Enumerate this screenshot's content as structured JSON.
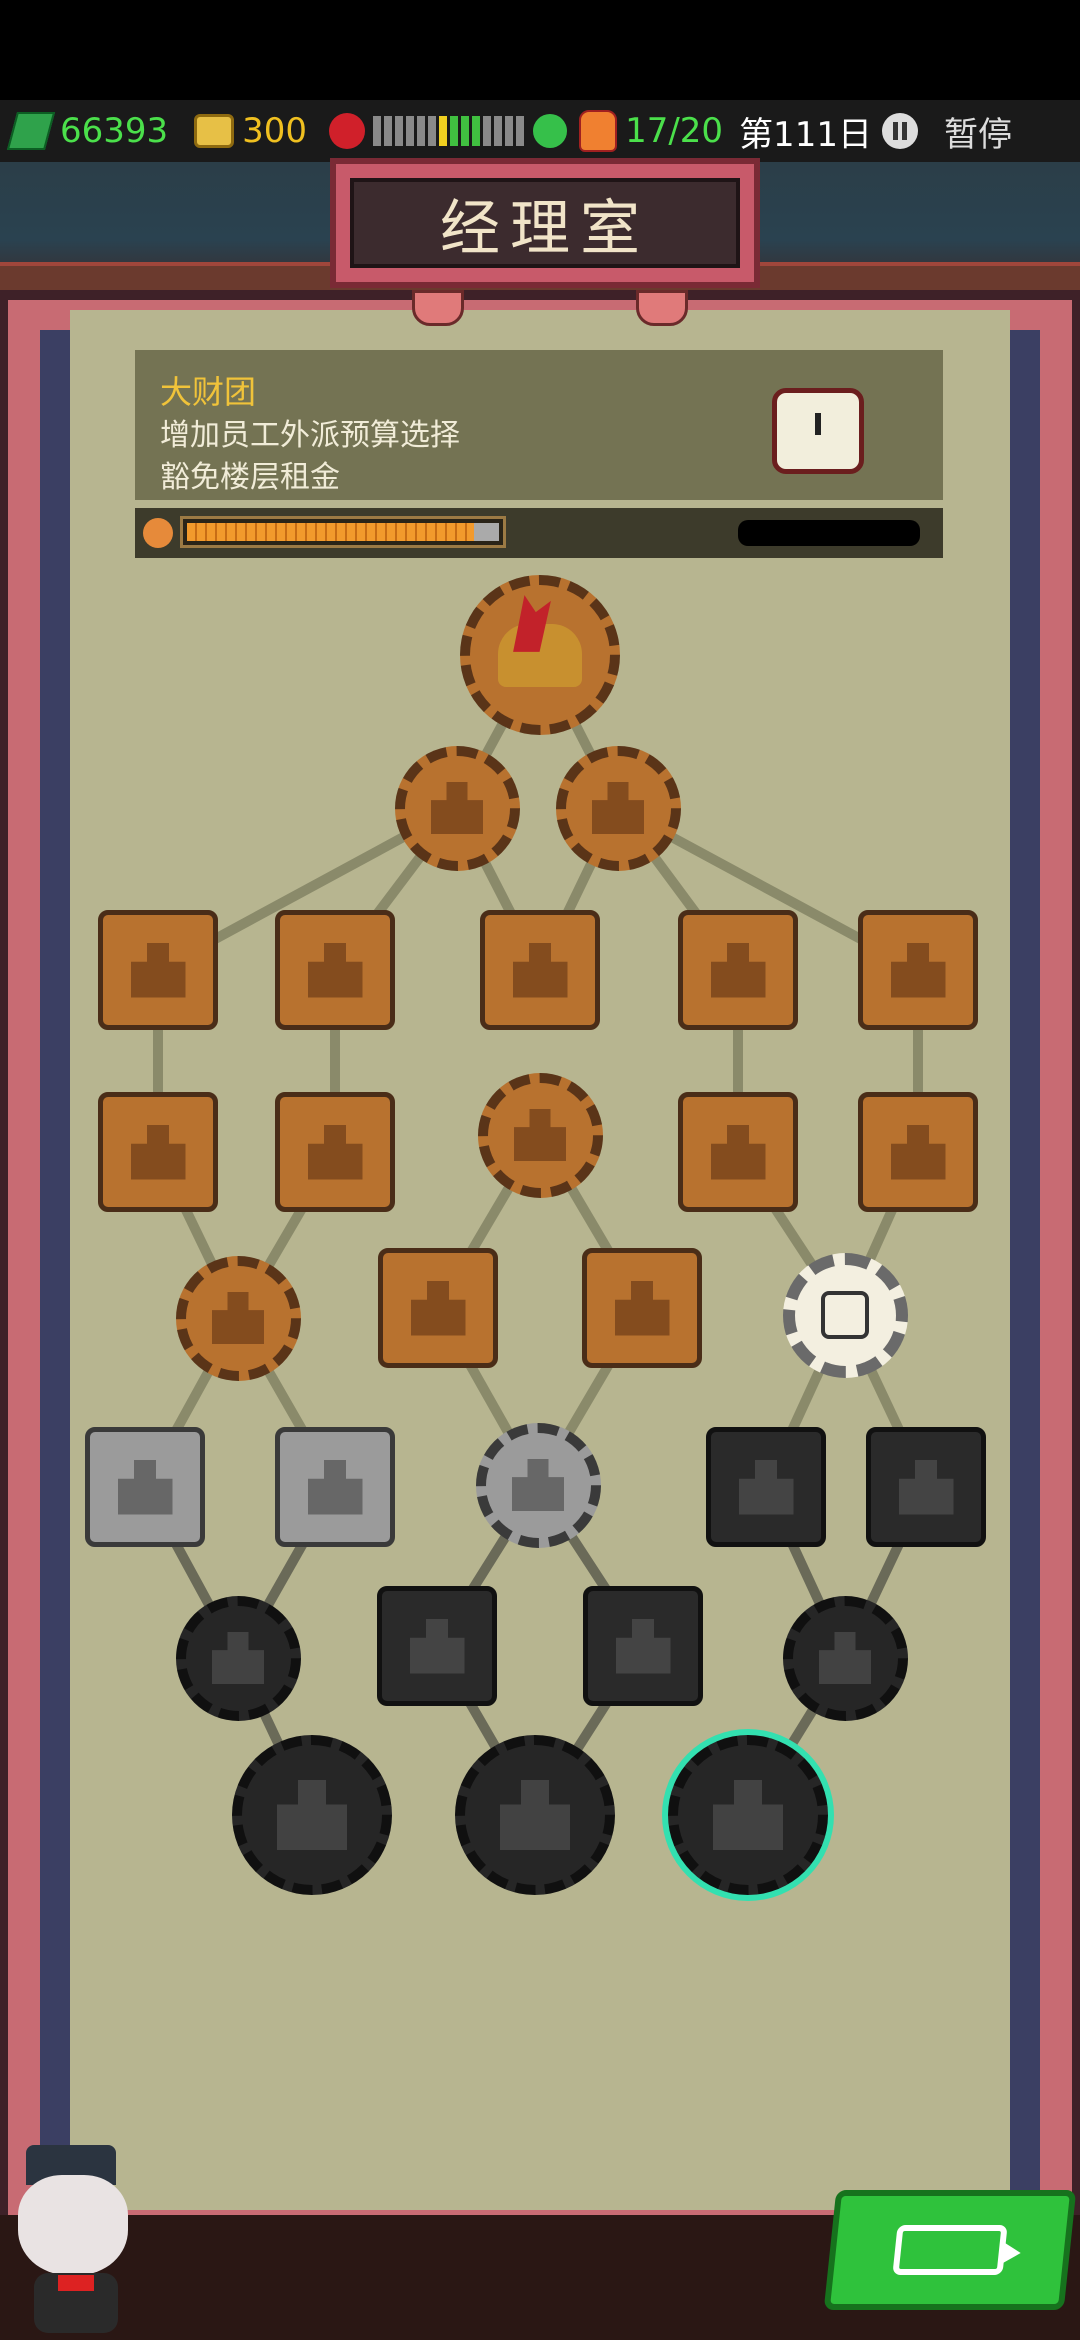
{
  "hud": {
    "cash": "66393",
    "coins": "300",
    "mood_segments": [
      "gray",
      "gray",
      "gray",
      "gray",
      "gray",
      "gray",
      "yellow",
      "green",
      "green",
      "green",
      "gray",
      "gray",
      "gray",
      "gray"
    ],
    "staff": "17/20",
    "day": "第111日",
    "pause_label": "暂停"
  },
  "title": "经理室",
  "info": {
    "name": "大财团",
    "line1": "增加员工外派预算选择",
    "line2": "豁免楼层租金",
    "progress_fraction": 0.92
  },
  "colors": {
    "bronze": "#b8722f",
    "gray": "#9b9b9b",
    "dark": "#262626",
    "panel": "#b7b590",
    "accent_green": "#2fc23c",
    "selected_glow": "#33e0b0"
  },
  "tree": {
    "root": {
      "icon": "rooster-icon",
      "state": "bronze",
      "shape": "gear"
    },
    "row1": [
      {
        "icon": "cake-icon",
        "state": "bronze",
        "shape": "gear"
      },
      {
        "icon": "brick-wall-icon",
        "state": "bronze",
        "shape": "gear"
      }
    ],
    "row2": [
      {
        "icon": "skeleton-throne-icon",
        "state": "bronze",
        "shape": "square"
      },
      {
        "icon": "skeleton-pedestal-icon",
        "state": "bronze",
        "shape": "square"
      },
      {
        "icon": "skeleton-desk-icon",
        "state": "bronze",
        "shape": "square"
      },
      {
        "icon": "skeleton-heart-icon",
        "state": "bronze",
        "shape": "square"
      },
      {
        "icon": "skeleton-counter-icon",
        "state": "bronze",
        "shape": "square"
      }
    ],
    "row3": [
      {
        "icon": "target-cross-icon",
        "state": "bronze",
        "shape": "square"
      },
      {
        "icon": "bench-icon",
        "state": "bronze",
        "shape": "square"
      },
      {
        "icon": "diamond-hand-icon",
        "state": "bronze",
        "shape": "gear"
      },
      {
        "icon": "skeleton-group-icon",
        "state": "bronze",
        "shape": "square"
      },
      {
        "icon": "diamond-tile-icon",
        "state": "bronze",
        "shape": "square"
      }
    ],
    "row4": [
      {
        "icon": "sword-icon",
        "state": "bronze",
        "shape": "gear"
      },
      {
        "icon": "skeleton-trio-icon",
        "state": "bronze",
        "shape": "square"
      },
      {
        "icon": "skeleton-family-icon",
        "state": "bronze",
        "shape": "square"
      },
      {
        "icon": "clock-icon",
        "state": "gray-white",
        "shape": "gear"
      }
    ],
    "row5": [
      {
        "icon": "skeleton-bench-icon",
        "state": "gray",
        "shape": "square"
      },
      {
        "icon": "skull-circle-icon",
        "state": "gray",
        "shape": "square"
      },
      {
        "icon": "skeleton-crowd-icon",
        "state": "gray",
        "shape": "gear"
      },
      {
        "icon": "signpost-icon",
        "state": "dark",
        "shape": "square"
      },
      {
        "icon": "rifle-icon",
        "state": "dark",
        "shape": "square"
      }
    ],
    "row6": [
      {
        "icon": "wrench-icon",
        "state": "dark",
        "shape": "gear"
      },
      {
        "icon": "lips-icon",
        "state": "dark",
        "shape": "square"
      },
      {
        "icon": "flag-icon",
        "state": "dark",
        "shape": "square"
      },
      {
        "icon": "cycle-arrows-icon",
        "state": "dark",
        "shape": "gear"
      }
    ],
    "row7": [
      {
        "icon": "tools-robot-icon",
        "state": "dark",
        "shape": "gear"
      },
      {
        "icon": "handshake-icon",
        "state": "dark",
        "shape": "gear"
      },
      {
        "icon": "pillar-icon",
        "state": "dark",
        "shape": "gear",
        "selected": true
      }
    ]
  },
  "back_button_icon": "back-arrow-icon",
  "manager_icon": "cat-manager-icon"
}
